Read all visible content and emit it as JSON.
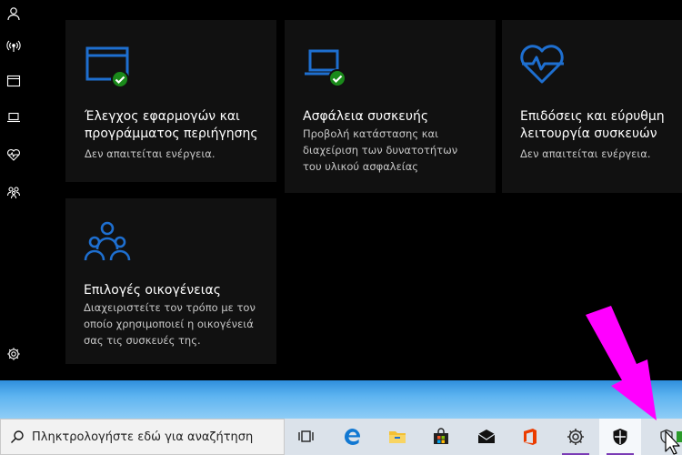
{
  "sidebar": {
    "items": [
      {
        "icon": "person-icon"
      },
      {
        "icon": "wireless-icon"
      },
      {
        "icon": "app-browser-icon"
      },
      {
        "icon": "laptop-icon"
      },
      {
        "icon": "heart-pulse-icon"
      },
      {
        "icon": "family-icon"
      }
    ],
    "settings_icon": "gear-icon"
  },
  "tiles": [
    {
      "title": "Έλεγχος εφαρμογών και προγράμματος περιήγησης",
      "title_line1": "Έλεγχος εφαρμογών και",
      "title_line2": "προγράμματος περιήγησης",
      "desc": "Δεν απαιτείται ενέργεια.",
      "icon": "app-browser-icon",
      "status": "ok"
    },
    {
      "title": "Ασφάλεια συσκευής",
      "desc_line1": "Προβολή κατάστασης και",
      "desc_line2": "διαχείριση των δυνατοτήτων",
      "desc_line3": "του υλικού ασφαλείας",
      "icon": "laptop-icon",
      "status": "ok"
    },
    {
      "title_line1": "Επιδόσεις και εύρυθμη",
      "title_line2": "λειτουργία συσκευών",
      "desc": "Δεν απαιτείται ενέργεια.",
      "icon": "heart-pulse-icon"
    },
    {
      "title": "Επιλογές οικογένειας",
      "desc_line1": "Διαχειριστείτε τον τρόπο με τον",
      "desc_line2": "οποίο χρησιμοποιεί η οικογένειά",
      "desc_line3": "σας τις συσκευές της.",
      "icon": "family-icon"
    }
  ],
  "taskbar": {
    "search_placeholder": "Πληκτρολογήστε εδώ για αναζήτηση",
    "apps": [
      "task-view-icon",
      "edge-icon",
      "file-explorer-icon",
      "store-icon",
      "mail-icon",
      "office-icon",
      "settings-icon",
      "windows-security-icon"
    ],
    "tray": [
      "security-tray-icon"
    ]
  },
  "colors": {
    "accent": "#1e6fd0",
    "ok": "#1a8a1a",
    "arrow": "#ff00ff"
  }
}
